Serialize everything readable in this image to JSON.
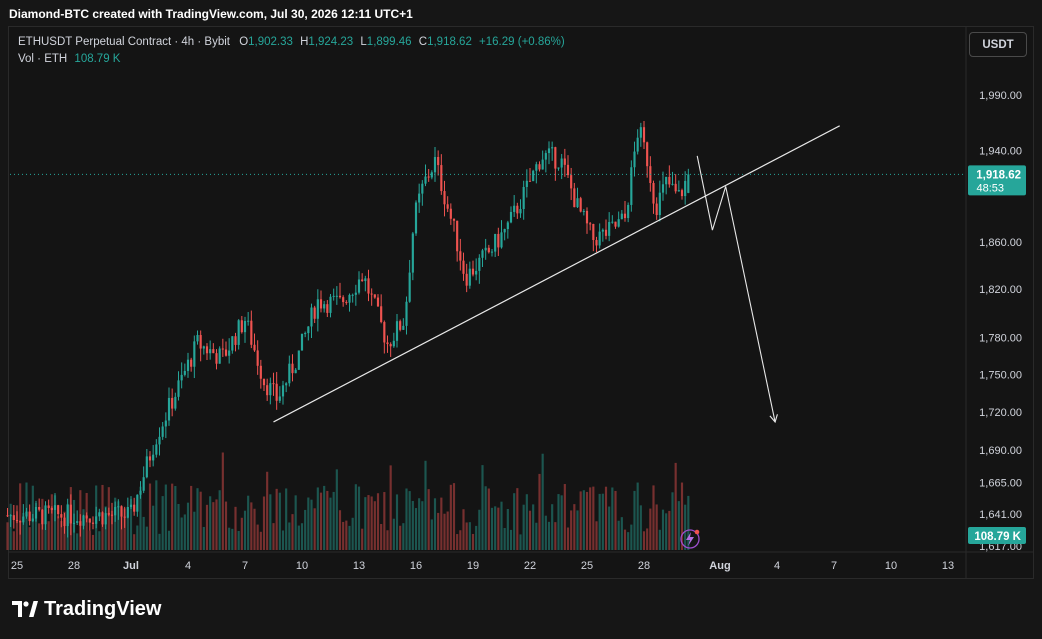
{
  "header": {
    "attribution": "Diamond-BTC created with TradingView.com, Jul 30, 2026 12:11 UTC+1"
  },
  "legend": {
    "symbol": "ETHUSDT Perpetual Contract · 4h · Bybit",
    "o_label": "O",
    "o_value": "1,902.33",
    "h_label": "H",
    "h_value": "1,924.23",
    "l_label": "L",
    "l_value": "1,899.46",
    "c_label": "C",
    "c_value": "1,918.62",
    "change": "+16.29 (+0.86%)",
    "vol_label": "Vol · ETH",
    "vol_value": "108.79 K"
  },
  "currency_button": "USDT",
  "footer": {
    "brand": "TradingView"
  },
  "colors": {
    "up": "#26a69a",
    "down": "#ef5350",
    "background": "#141414",
    "grid": "#1f1f1f",
    "last_price_tag": "#26a69a"
  },
  "chart_data": {
    "type": "candlestick",
    "interval": "4h",
    "price_scale": "log",
    "grid": false,
    "ylim": [
      1617,
      2030
    ],
    "y_ticks": [
      "1,990.00",
      "1,940.00",
      "1,860.00",
      "1,820.00",
      "1,780.00",
      "1,750.00",
      "1,720.00",
      "1,690.00",
      "1,665.00",
      "1,641.00",
      "1,617.00"
    ],
    "y_tick_values": [
      1990,
      1940,
      1860,
      1820,
      1780,
      1750,
      1720,
      1690,
      1665,
      1641,
      1617
    ],
    "x_ticks": [
      "25",
      "28",
      "Jul",
      "4",
      "7",
      "10",
      "13",
      "16",
      "19",
      "22",
      "25",
      "28",
      "Aug",
      "4",
      "7",
      "10",
      "13"
    ],
    "x_tick_days": [
      -6,
      -3,
      0,
      3,
      6,
      9,
      12,
      15,
      18,
      21,
      24,
      27,
      31,
      34,
      37,
      40,
      43
    ],
    "last_price": {
      "value": 1918.62,
      "label": "1,918.62",
      "countdown": "48:53"
    },
    "volume_last": {
      "label": "108.79 K"
    },
    "key_closes": [
      {
        "day": -6.5,
        "price": 1640
      },
      {
        "day": 0.0,
        "price": 1640
      },
      {
        "day": 1.3,
        "price": 1700
      },
      {
        "day": 2.5,
        "price": 1740
      },
      {
        "day": 3.5,
        "price": 1775
      },
      {
        "day": 4.8,
        "price": 1763
      },
      {
        "day": 6.0,
        "price": 1795
      },
      {
        "day": 7.0,
        "price": 1745
      },
      {
        "day": 7.7,
        "price": 1730
      },
      {
        "day": 8.8,
        "price": 1765
      },
      {
        "day": 9.8,
        "price": 1810
      },
      {
        "day": 11.0,
        "price": 1808
      },
      {
        "day": 12.2,
        "price": 1832
      },
      {
        "day": 13.5,
        "price": 1775
      },
      {
        "day": 14.4,
        "price": 1795
      },
      {
        "day": 14.9,
        "price": 1880
      },
      {
        "day": 15.4,
        "price": 1910
      },
      {
        "day": 16.0,
        "price": 1930
      },
      {
        "day": 17.0,
        "price": 1870
      },
      {
        "day": 17.6,
        "price": 1830
      },
      {
        "day": 18.8,
        "price": 1850
      },
      {
        "day": 19.8,
        "price": 1872
      },
      {
        "day": 20.8,
        "price": 1905
      },
      {
        "day": 21.6,
        "price": 1935
      },
      {
        "day": 22.6,
        "price": 1932
      },
      {
        "day": 23.5,
        "price": 1890
      },
      {
        "day": 24.3,
        "price": 1862
      },
      {
        "day": 25.1,
        "price": 1868
      },
      {
        "day": 26.0,
        "price": 1880
      },
      {
        "day": 26.7,
        "price": 1960
      },
      {
        "day": 27.2,
        "price": 1930
      },
      {
        "day": 27.6,
        "price": 1890
      },
      {
        "day": 28.2,
        "price": 1912
      },
      {
        "day": 28.8,
        "price": 1898
      },
      {
        "day": 29.4,
        "price": 1918.62
      }
    ],
    "trendline": {
      "from": {
        "day": 7.5,
        "price": 1712
      },
      "to": {
        "day": 37.3,
        "price": 1962
      }
    },
    "projection": [
      {
        "day": 29.8,
        "price": 1935
      },
      {
        "day": 30.6,
        "price": 1870
      },
      {
        "day": 31.3,
        "price": 1908
      },
      {
        "day": 33.9,
        "price": 1712
      }
    ]
  }
}
